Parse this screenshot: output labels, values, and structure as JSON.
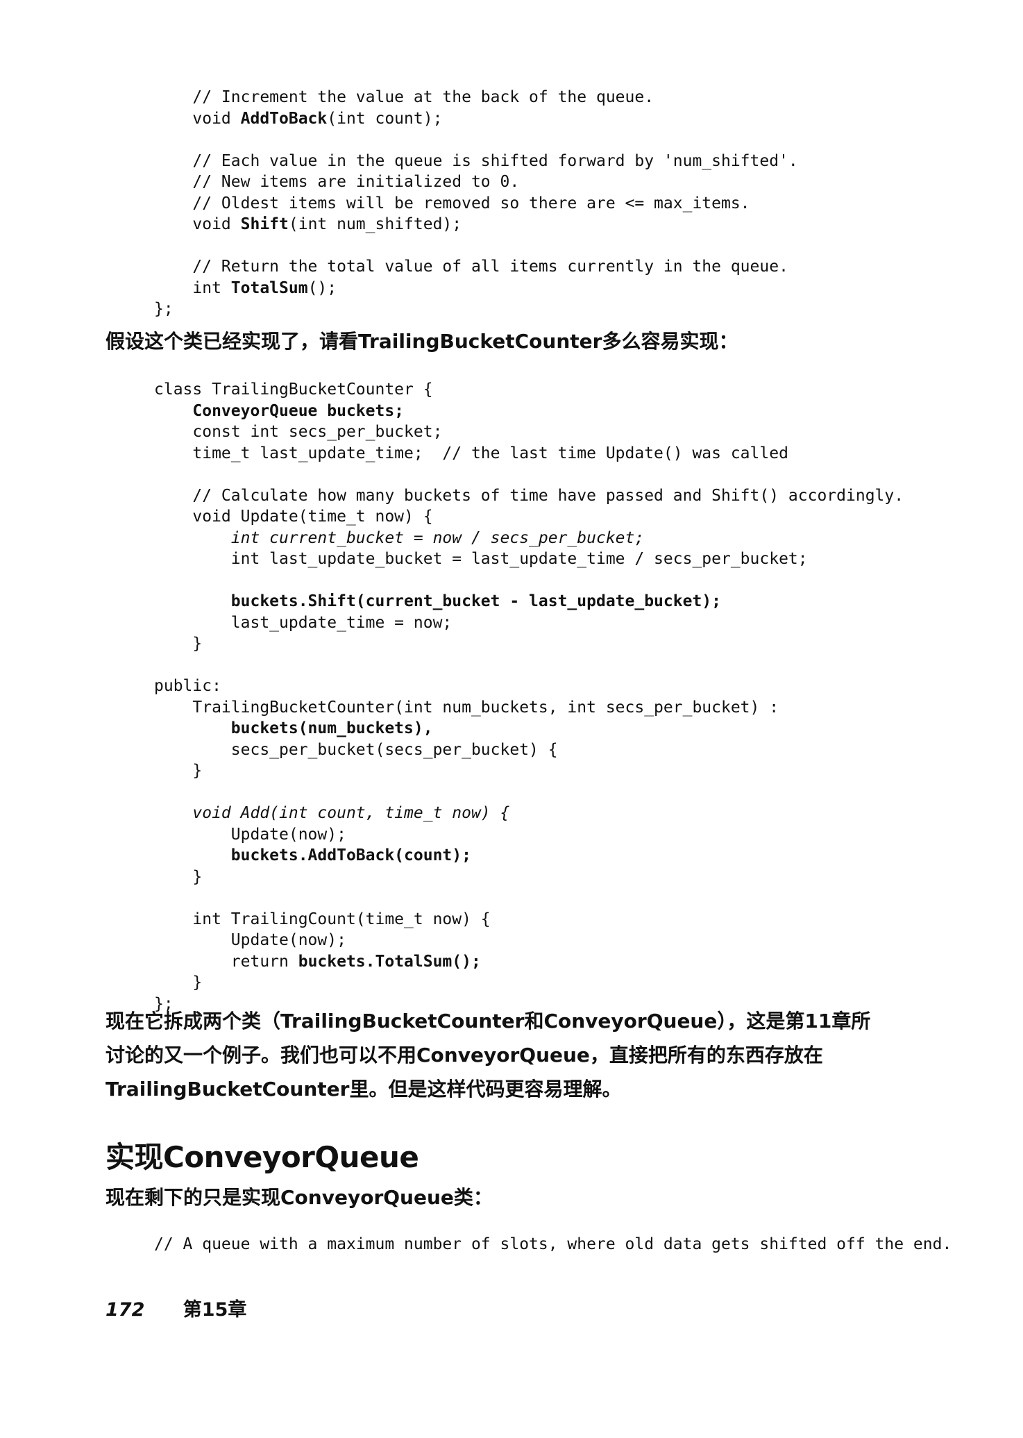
{
  "code_block_1": [
    "    // Increment the value at the back of the queue.",
    "    void AddToBack(int count);",
    "",
    "    // Each value in the queue is shifted forward by 'num_shifted'.",
    "    // New items are initialized to 0.",
    "    // Oldest items will be removed so there are <= max_items.",
    "    void Shift(int num_shifted);",
    "",
    "    // Return the total value of all items currently in the queue.",
    "    int TotalSum();",
    "};"
  ],
  "paragraph_1": "假设这个类已经实现了，请看TrailingBucketCounter多么容易实现：",
  "code_block_2": [
    "class TrailingBucketCounter {",
    "    ConveyorQueue buckets;",
    "    const int secs_per_bucket;",
    "    time_t last_update_time;  // the last time Update() was called",
    "",
    "    // Calculate how many buckets of time have passed and Shift() accordingly.",
    "    void Update(time_t now) {",
    "        int current_bucket = now / secs_per_bucket;",
    "        int last_update_bucket = last_update_time / secs_per_bucket;",
    "",
    "        buckets.Shift(current_bucket - last_update_bucket);",
    "        last_update_time = now;",
    "    }",
    "",
    "public:",
    "    TrailingBucketCounter(int num_buckets, int secs_per_bucket) :",
    "        buckets(num_buckets),",
    "        secs_per_bucket(secs_per_bucket) {",
    "    }",
    "",
    "    void Add(int count, time_t now) {",
    "        Update(now);",
    "        buckets.AddToBack(count);",
    "    }",
    "",
    "    int TrailingCount(time_t now) {",
    "        Update(now);",
    "        return buckets.TotalSum();",
    "    }",
    "};"
  ],
  "paragraph_2": [
    "现在它拆成两个类（TrailingBucketCounter和ConveyorQueue），这是第11章所",
    "讨论的又一个例子。我们也可以不用ConveyorQueue，直接把所有的东西存放在",
    "TrailingBucketCounter里。但是这样代码更容易理解。"
  ],
  "section_heading": "实现ConveyorQueue",
  "paragraph_3": "现在剩下的只是实现ConveyorQueue类：",
  "code_block_3": [
    "// A queue with a maximum number of slots, where old data gets shifted off the end."
  ],
  "footer": {
    "page_number": "172",
    "chapter": "第15章"
  }
}
